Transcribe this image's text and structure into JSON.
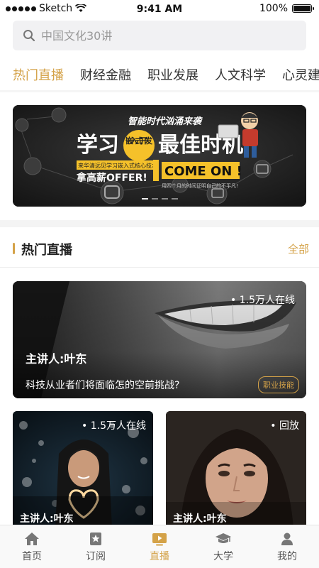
{
  "status_bar": {
    "carrier": "Sketch",
    "time": "9:41 AM",
    "battery": "100%"
  },
  "search": {
    "placeholder": "中国文化30讲"
  },
  "categories": [
    {
      "label": "热门直播",
      "active": true
    },
    {
      "label": "财经金融",
      "active": false
    },
    {
      "label": "职业发展",
      "active": false
    },
    {
      "label": "人文科学",
      "active": false
    },
    {
      "label": "心灵建设",
      "active": false
    }
  ],
  "banner": {
    "headline_top": "智能时代汹涌来袭",
    "headline_left": "学习",
    "badge": "嵌入式开发",
    "headline_right": "最佳时机",
    "subline": "来华清远见学习嵌入式核心技术",
    "offer": "拿高薪OFFER!",
    "come_on": "COME ON !",
    "slogan": "用四个月的时间证明自己的不平凡!",
    "slides": 4,
    "active_slide": 0
  },
  "section": {
    "title": "热门直播",
    "all_label": "全部"
  },
  "featured_live": {
    "viewers": "1.5万人在线",
    "host": "主讲人:叶东",
    "question": "科技从业者们将面临怎的空前挑战?",
    "tag": "职业技能"
  },
  "small_cards": [
    {
      "badge": "1.5万人在线",
      "host": "主讲人:叶东"
    },
    {
      "badge": "回放",
      "host": "主讲人:叶东"
    }
  ],
  "tabs": [
    {
      "label": "首页",
      "icon": "home-icon",
      "active": false
    },
    {
      "label": "订阅",
      "icon": "bookmark-star-icon",
      "active": false
    },
    {
      "label": "直播",
      "icon": "play-video-icon",
      "active": true
    },
    {
      "label": "大学",
      "icon": "graduation-cap-icon",
      "active": false
    },
    {
      "label": "我的",
      "icon": "user-icon",
      "active": false
    }
  ],
  "colors": {
    "accent": "#d4a248",
    "search_bg": "#f1f1f3",
    "tab_inactive": "#555555"
  }
}
